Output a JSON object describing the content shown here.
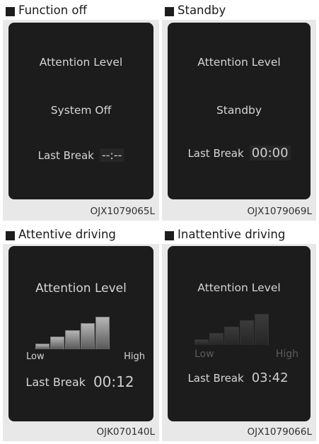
{
  "panels": [
    {
      "title": "Function off",
      "screen": {
        "attention_label": "Attention Level",
        "status": "System Off",
        "last_break_label": "Last Break",
        "last_break_value": "--:--"
      },
      "code": "OJX1079065L"
    },
    {
      "title": "Standby",
      "screen": {
        "attention_label": "Attention Level",
        "status": "Standby",
        "last_break_label": "Last Break",
        "last_break_value": "00:00"
      },
      "code": "OJX1079069L"
    },
    {
      "title": "Attentive driving",
      "screen": {
        "attention_label": "Attention Level",
        "low_label": "Low",
        "high_label": "High",
        "last_break_label": "Last Break",
        "last_break_value": "00:12",
        "attention_bars_lit": 5,
        "attention_bars_total": 5
      },
      "code": "OJK070140L"
    },
    {
      "title": "Inattentive driving",
      "screen": {
        "attention_label": "Attention Level",
        "low_label": "Low",
        "high_label": "High",
        "last_break_label": "Last Break",
        "last_break_value": "03:42",
        "attention_bars_lit": 0,
        "attention_bars_total": 5
      },
      "code": "OJX1079066L"
    }
  ],
  "colors": {
    "screen_bg": "#1c1c1c",
    "panel_bg": "#e8e8e8",
    "text": "#d6d6d6"
  }
}
